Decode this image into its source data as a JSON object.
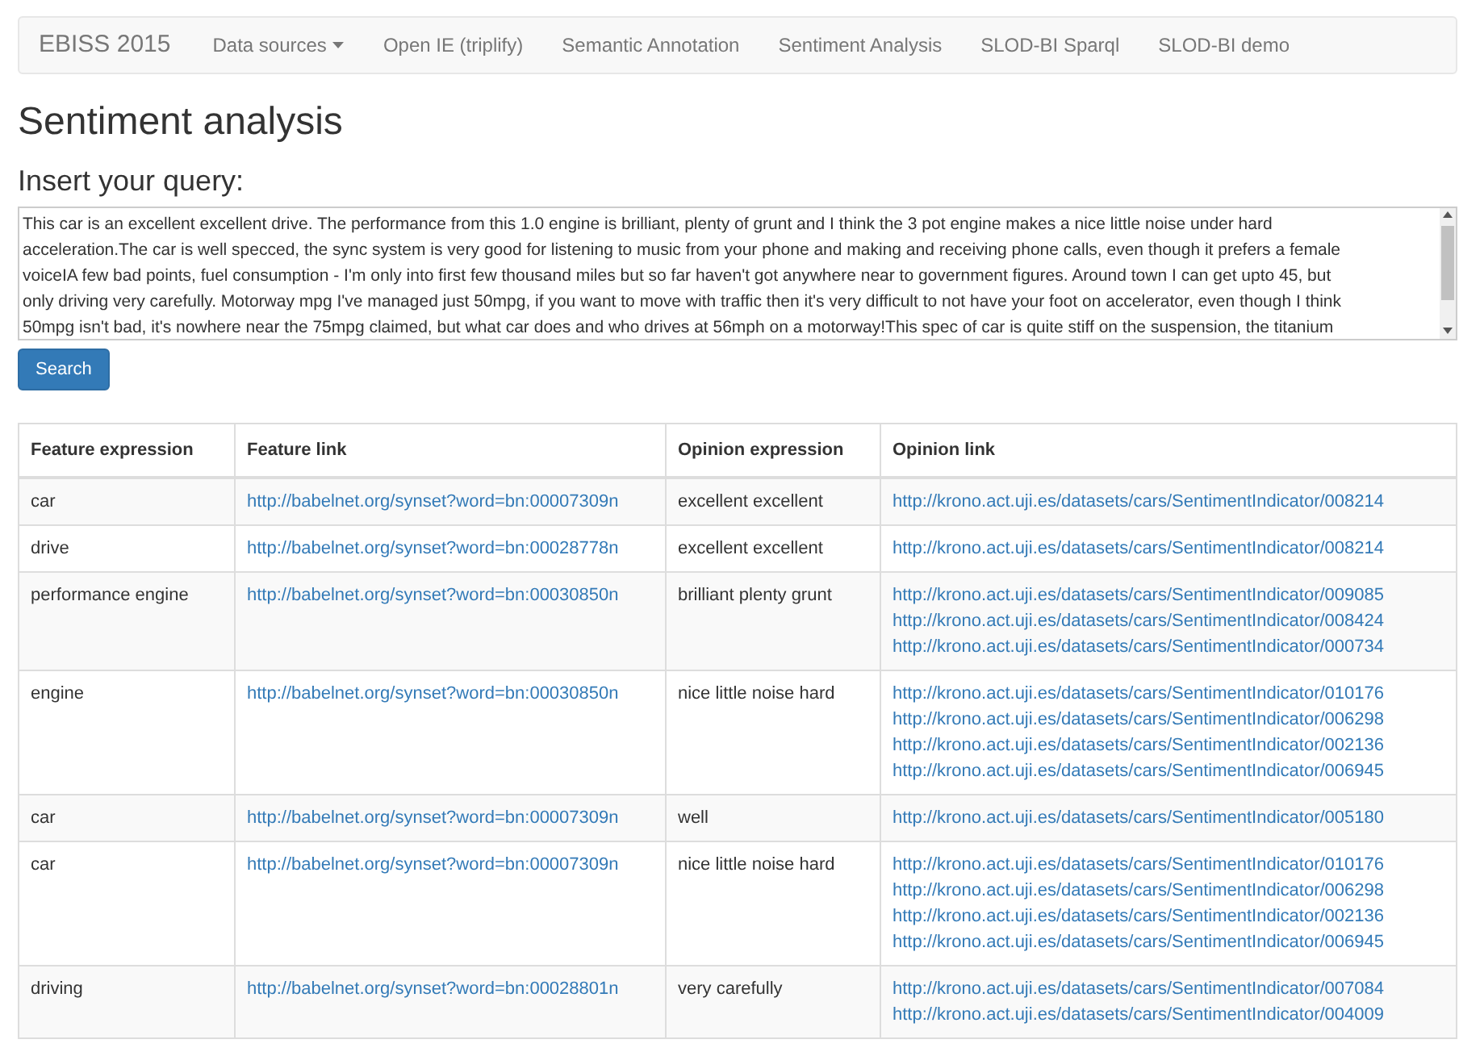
{
  "navbar": {
    "brand": "EBISS 2015",
    "items": [
      {
        "label": "Data sources",
        "kind": "dropdown",
        "selected": false
      },
      {
        "label": "Open IE (triplify)",
        "kind": "link",
        "selected": false
      },
      {
        "label": "Semantic Annotation",
        "kind": "link",
        "selected": false
      },
      {
        "label": "Sentiment Analysis",
        "kind": "link",
        "selected": false
      },
      {
        "label": "SLOD-BI Sparql",
        "kind": "link",
        "selected": false
      },
      {
        "label": "SLOD-BI demo",
        "kind": "link",
        "selected": false
      }
    ]
  },
  "heading": "Sentiment analysis",
  "query": {
    "label": "Insert your query:",
    "value_lines": [
      "This car is an excellent excellent drive. The performance from this 1.0 engine is brilliant, plenty of grunt and I think the 3 pot engine makes a nice little noise under hard",
      "acceleration.The car is well specced, the sync system is very good for listening to music from your phone and making and receiving phone calls, even though it prefers a female",
      "voiceIA few bad points, fuel consumption - I'm only into first few thousand miles but so far haven't got anywhere near to government figures. Around town I can get upto 45, but",
      "only driving very carefully. Motorway mpg I've managed just 50mpg, if you want to move with traffic then it's very difficult to not have your foot on accelerator, even though I think",
      "50mpg isn't bad, it's nowhere near the 75mpg claimed, but what car does and who drives at 56mph on a motorway!This spec of car is quite stiff on the suspension, the titanium"
    ],
    "button": "Search"
  },
  "table": {
    "columns": [
      "Feature expression",
      "Feature link",
      "Opinion expression",
      "Opinion link"
    ],
    "rows": [
      {
        "feature": "car",
        "feature_link": "http://babelnet.org/synset?word=bn:00007309n",
        "opinion": "excellent excellent",
        "opinion_links": [
          "http://krono.act.uji.es/datasets/cars/SentimentIndicator/008214"
        ]
      },
      {
        "feature": "drive",
        "feature_link": "http://babelnet.org/synset?word=bn:00028778n",
        "opinion": "excellent excellent",
        "opinion_links": [
          "http://krono.act.uji.es/datasets/cars/SentimentIndicator/008214"
        ]
      },
      {
        "feature": "performance engine",
        "feature_link": "http://babelnet.org/synset?word=bn:00030850n",
        "opinion": "brilliant plenty grunt",
        "opinion_links": [
          "http://krono.act.uji.es/datasets/cars/SentimentIndicator/009085",
          "http://krono.act.uji.es/datasets/cars/SentimentIndicator/008424",
          "http://krono.act.uji.es/datasets/cars/SentimentIndicator/000734"
        ]
      },
      {
        "feature": "engine",
        "feature_link": "http://babelnet.org/synset?word=bn:00030850n",
        "opinion": "nice little noise hard",
        "opinion_links": [
          "http://krono.act.uji.es/datasets/cars/SentimentIndicator/010176",
          "http://krono.act.uji.es/datasets/cars/SentimentIndicator/006298",
          "http://krono.act.uji.es/datasets/cars/SentimentIndicator/002136",
          "http://krono.act.uji.es/datasets/cars/SentimentIndicator/006945"
        ]
      },
      {
        "feature": "car",
        "feature_link": "http://babelnet.org/synset?word=bn:00007309n",
        "opinion": "well",
        "opinion_links": [
          "http://krono.act.uji.es/datasets/cars/SentimentIndicator/005180"
        ]
      },
      {
        "feature": "car",
        "feature_link": "http://babelnet.org/synset?word=bn:00007309n",
        "opinion": "nice little noise hard",
        "opinion_links": [
          "http://krono.act.uji.es/datasets/cars/SentimentIndicator/010176",
          "http://krono.act.uji.es/datasets/cars/SentimentIndicator/006298",
          "http://krono.act.uji.es/datasets/cars/SentimentIndicator/002136",
          "http://krono.act.uji.es/datasets/cars/SentimentIndicator/006945"
        ]
      },
      {
        "feature": "driving",
        "feature_link": "http://babelnet.org/synset?word=bn:00028801n",
        "opinion": "very carefully",
        "opinion_links": [
          "http://krono.act.uji.es/datasets/cars/SentimentIndicator/007084",
          "http://krono.act.uji.es/datasets/cars/SentimentIndicator/004009"
        ]
      }
    ]
  }
}
